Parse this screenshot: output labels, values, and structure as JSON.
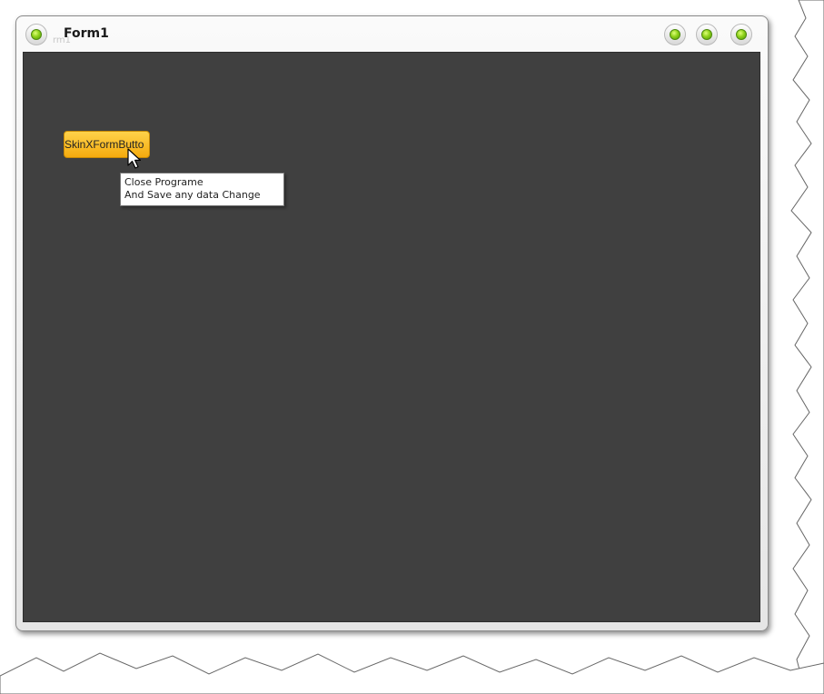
{
  "window": {
    "title": "Form1",
    "title_ghost": "rm1",
    "controls": [
      {
        "name": "minimize-button",
        "icon": "green-orb-icon"
      },
      {
        "name": "maximize-button",
        "icon": "green-orb-icon"
      },
      {
        "name": "close-button",
        "icon": "green-orb-icon"
      }
    ],
    "app_icon": "green-orb-icon"
  },
  "form": {
    "button_label": "SkinXFormButto",
    "tooltip": {
      "line1": "Close Programe",
      "line2": "And Save any data Change"
    }
  },
  "colors": {
    "client_background": "#404040",
    "button_fill": "#f5ab0e",
    "orb_green": "#8fd21b"
  }
}
